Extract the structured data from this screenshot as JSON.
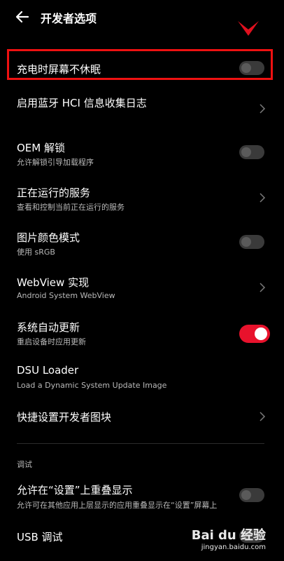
{
  "header": {
    "title": "开发者选项"
  },
  "items": [
    {
      "label": "充电时屏幕不休眠",
      "control": "toggle",
      "state": "off"
    },
    {
      "label": "启用蓝牙 HCI 信息收集日志",
      "control": "chevron"
    },
    {
      "label": "OEM 解锁",
      "sub": "允许解锁引导加载程序",
      "control": "toggle",
      "state": "off"
    },
    {
      "label": "正在运行的服务",
      "sub": "查看和控制当前正在运行的服务",
      "control": "chevron"
    },
    {
      "label": "图片颜色模式",
      "sub": "使用 sRGB",
      "control": "toggle",
      "state": "off"
    },
    {
      "label": "WebView 实现",
      "sub": "Android System WebView",
      "control": "chevron"
    },
    {
      "label": "系统自动更新",
      "sub": "重启设备时应用更新",
      "control": "toggle",
      "state": "on"
    },
    {
      "label": "DSU Loader",
      "sub": "Load a Dynamic System Update Image"
    },
    {
      "label": "快捷设置开发者图块",
      "control": "chevron"
    },
    {
      "label": "允许在“设置”上重叠显示",
      "sub": "允许可在其他应用上层显示的应用重叠显示在“设置”屏幕上",
      "control": "toggle",
      "state": "off"
    },
    {
      "label": "USB 调试",
      "control": "toggle",
      "state": "off"
    }
  ],
  "section_debug": "调试",
  "watermark": {
    "logo": "Bai du 经验",
    "url": "jingyan.baidu.com"
  },
  "colors": {
    "accent": "#e8122c",
    "highlight": "#ee1111",
    "background": "#000000"
  }
}
